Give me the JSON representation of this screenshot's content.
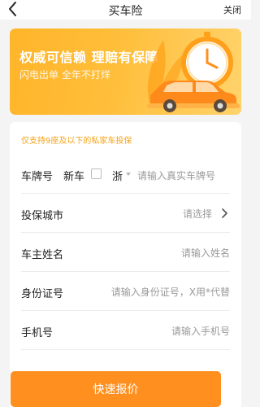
{
  "nav": {
    "title": "买车险",
    "close_label": "关闭",
    "back_icon": "chevron-left-icon"
  },
  "banner": {
    "headline": "权威可信赖 理赔有保障",
    "subline": "闪电出单 全年不打烊",
    "illustration": "car-and-clock"
  },
  "form": {
    "notice": "仅支持9座及以下的私家车投保",
    "plate": {
      "label": "车牌号",
      "new_car_label": "新车",
      "new_car_checked": false,
      "province": "浙",
      "placeholder": "请输入真实车牌号"
    },
    "city": {
      "label": "投保城市",
      "placeholder": "请选择",
      "chevron_icon": "chevron-right-icon"
    },
    "owner": {
      "label": "车主姓名",
      "placeholder": "请输入姓名"
    },
    "id_card": {
      "label": "身份证号",
      "placeholder": "请输入身份证号，X用*代替"
    },
    "phone": {
      "label": "手机号",
      "placeholder": "请输入手机号"
    },
    "submit_label": "快速报价"
  },
  "colors": {
    "accent": "#ff8f1e",
    "banner_start": "#ffb52a",
    "banner_end": "#ffd36c",
    "notice": "#f5a317",
    "background": "#f4f4f4"
  }
}
